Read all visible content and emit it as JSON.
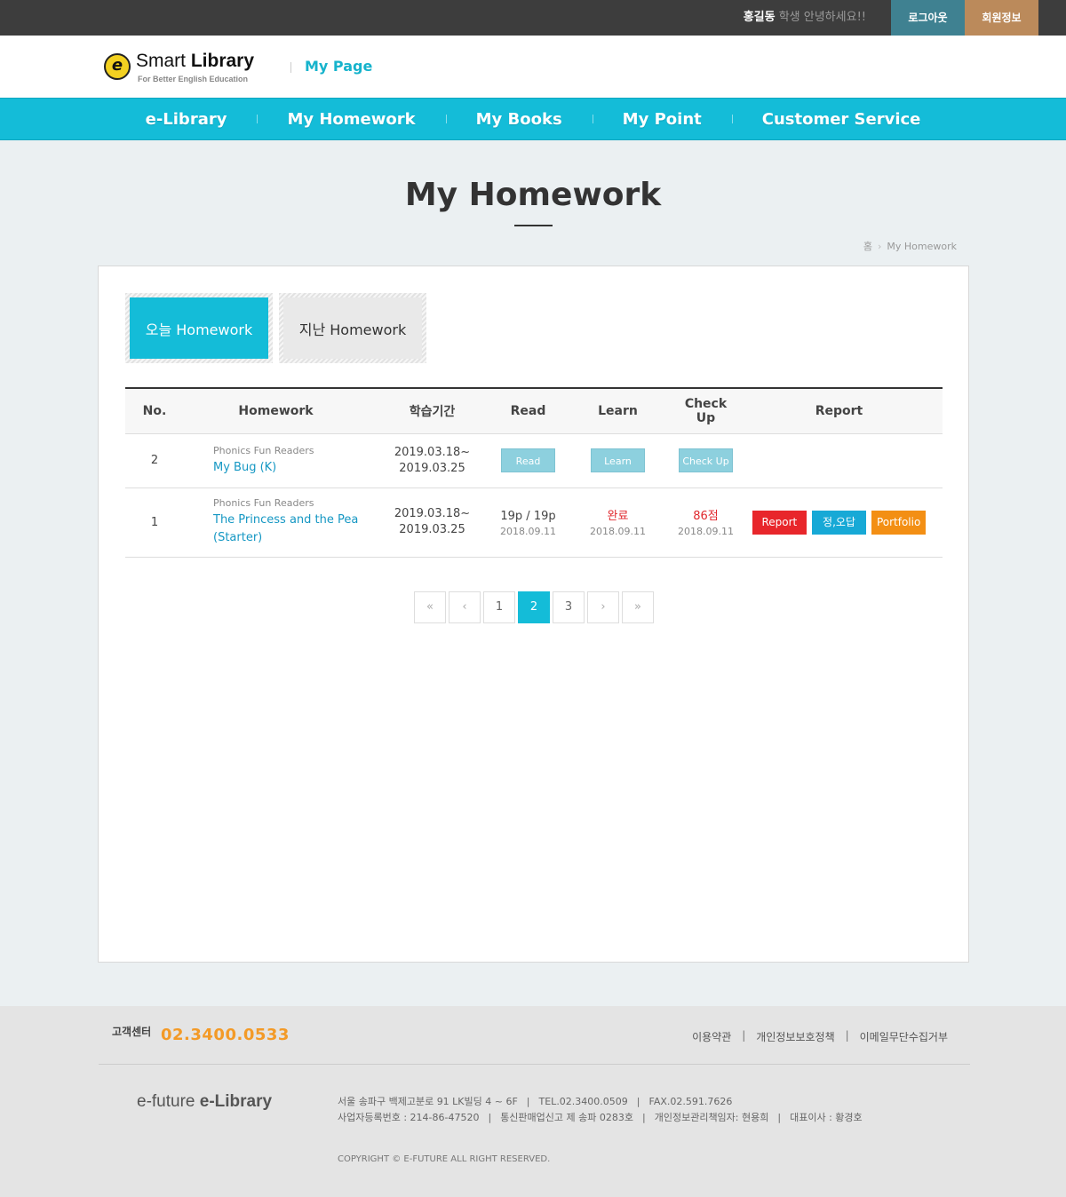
{
  "topbar": {
    "user_name": "홍길동",
    "greeting": " 학생 안녕하세요!!",
    "logout_label": "로그아웃",
    "member_label": "회원정보"
  },
  "header": {
    "logo_letter": "e",
    "logo_name_1": "Smart ",
    "logo_name_2": "Library",
    "logo_tagline": "For Better English Education",
    "section": "My Page"
  },
  "nav": {
    "items": [
      {
        "label": "e-Library"
      },
      {
        "label": "My Homework"
      },
      {
        "label": "My Books"
      },
      {
        "label": "My Point"
      },
      {
        "label": "Customer Service"
      }
    ]
  },
  "page": {
    "title": "My Homework",
    "breadcrumb_home": "홈",
    "breadcrumb_current": "My Homework"
  },
  "tabs": {
    "today": "오늘 Homework",
    "past": "지난 Homework"
  },
  "table": {
    "headers": {
      "no": "No.",
      "homework": "Homework",
      "period": "학습기간",
      "read": "Read",
      "learn": "Learn",
      "checkup": "Check Up",
      "report": "Report"
    },
    "rows": [
      {
        "no": "2",
        "series": "Phonics Fun Readers",
        "title": "My Bug (K)",
        "period_start": "2019.03.18~",
        "period_end": "2019.03.25",
        "read_btn": "Read",
        "learn_btn": "Learn",
        "checkup_btn": "Check Up"
      },
      {
        "no": "1",
        "series": "Phonics Fun Readers",
        "title_1": "The Princess and the Pea",
        "title_2": "(Starter)",
        "period_start": "2019.03.18~",
        "period_end": "2019.03.25",
        "read_value": "19p / 19p",
        "read_date": "2018.09.11",
        "learn_value": "완료",
        "learn_date": "2018.09.11",
        "checkup_value": "86점",
        "checkup_date": "2018.09.11",
        "report_btn": "Report",
        "answer_btn": "정,오답",
        "portfolio_btn": "Portfolio"
      }
    ]
  },
  "pager": {
    "first": "«",
    "prev": "‹",
    "pages": [
      "1",
      "2",
      "3"
    ],
    "current": "2",
    "next": "›",
    "last": "»"
  },
  "footer": {
    "cs_label": "고객센터",
    "phone": "02.3400.0533",
    "links": [
      "이용약관",
      "개인정보보호정책",
      "이메일무단수집거부"
    ],
    "logo_1": "e-future ",
    "logo_2": "e-Library",
    "address": "서울 송파구 백제고분로 91 LK빌딩 4 ~ 6F",
    "tel": "TEL.02.3400.0509",
    "fax": "FAX.02.591.7626",
    "biz_no": "사업자등록번호 : 214-86-47520",
    "mail_order": "통신판매업신고 제 송파 0283호",
    "privacy_officer": "개인정보관리책임자: 현용희",
    "ceo": "대표이사 : 황경호",
    "copyright": "COPYRIGHT © E-FUTURE ALL RIGHT RESERVED."
  },
  "colors": {
    "accent": "#14bcd8",
    "red": "#e8262b",
    "orange": "#f38f14",
    "blue": "#17a9d6",
    "phone": "#f39a27"
  }
}
